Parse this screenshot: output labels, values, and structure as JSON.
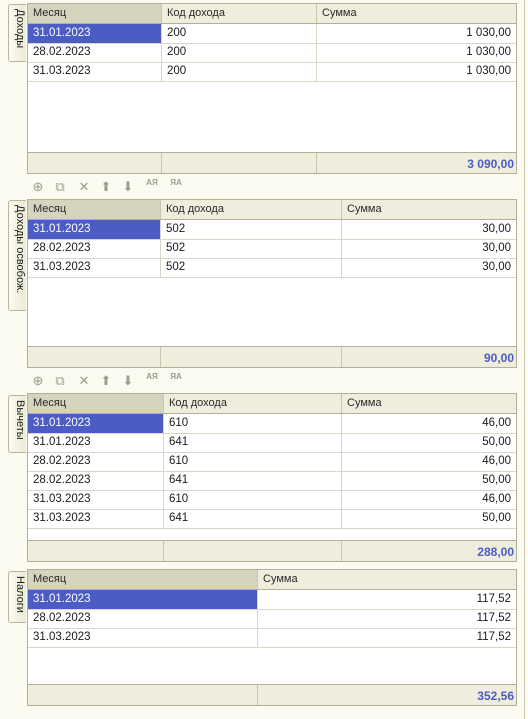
{
  "sections": {
    "income": {
      "tab": "Доходы",
      "columns": [
        "Месяц",
        "Код дохода",
        "Сумма"
      ],
      "rows": [
        [
          "31.01.2023",
          "200",
          "1 030,00"
        ],
        [
          "28.02.2023",
          "200",
          "1 030,00"
        ],
        [
          "31.03.2023",
          "200",
          "1 030,00"
        ]
      ],
      "total": "3 090,00"
    },
    "exempt": {
      "tab": "Доходы освобож.",
      "columns": [
        "Месяц",
        "Код дохода",
        "Сумма"
      ],
      "rows": [
        [
          "31.01.2023",
          "502",
          "30,00"
        ],
        [
          "28.02.2023",
          "502",
          "30,00"
        ],
        [
          "31.03.2023",
          "502",
          "30,00"
        ]
      ],
      "total": "90,00"
    },
    "deductions": {
      "tab": "Вычеты",
      "columns": [
        "Месяц",
        "Код дохода",
        "Сумма"
      ],
      "rows": [
        [
          "31.01.2023",
          "610",
          "46,00"
        ],
        [
          "31.01.2023",
          "641",
          "50,00"
        ],
        [
          "28.02.2023",
          "610",
          "46,00"
        ],
        [
          "28.02.2023",
          "641",
          "50,00"
        ],
        [
          "31.03.2023",
          "610",
          "46,00"
        ],
        [
          "31.03.2023",
          "641",
          "50,00"
        ]
      ],
      "total": "288,00"
    },
    "taxes": {
      "tab": "Налоги",
      "columns": [
        "Месяц",
        "Сумма"
      ],
      "rows": [
        [
          "31.01.2023",
          "117,52"
        ],
        [
          "28.02.2023",
          "117,52"
        ],
        [
          "31.03.2023",
          "117,52"
        ]
      ],
      "total": "352,56"
    }
  },
  "toolbar": {
    "icons": [
      "add-row-icon",
      "copy-row-icon",
      "delete-row-icon",
      "move-up-icon",
      "move-down-icon",
      "sort-ascending-icon",
      "sort-descending-icon"
    ],
    "sort_asc_text": "АЯ",
    "sort_desc_text": "ЯА"
  },
  "colors": {
    "selection": "#4b5cc4",
    "header_bg": "#efeddc",
    "border": "#b3b09a",
    "total_text": "#4b5cc4"
  }
}
